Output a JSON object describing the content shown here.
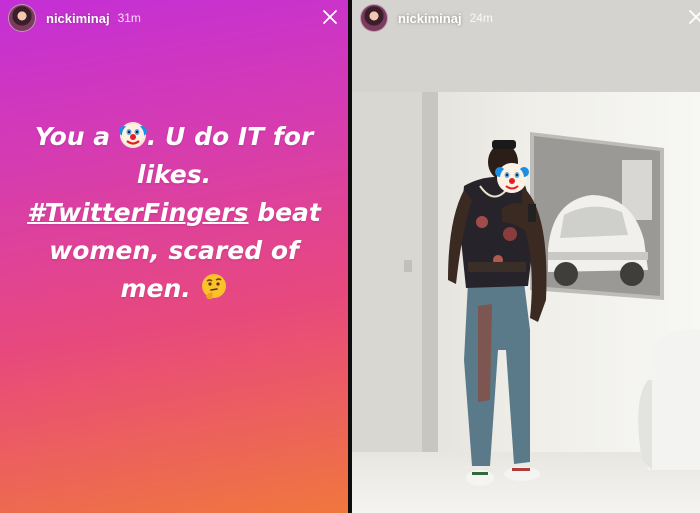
{
  "stories": [
    {
      "username": "nickiminaj",
      "time": "31m",
      "text": {
        "line1_before": "You a ",
        "line1_after": ". U do IT for",
        "line2": "likes.",
        "hashtag": "#TwitterFingers",
        "line3_after": " beat",
        "line4": "women, scared of",
        "line5": "men. "
      },
      "emojis": [
        "clown-face-icon",
        "thinking-face-icon"
      ]
    },
    {
      "username": "nickiminaj",
      "time": "24m",
      "photo": "man-in-mirror-photo"
    }
  ],
  "colors": {
    "gradient_top": "#c42fd6",
    "gradient_mid": "#e8497c",
    "gradient_bottom": "#f0773e",
    "divider": "#0d0d0d"
  }
}
